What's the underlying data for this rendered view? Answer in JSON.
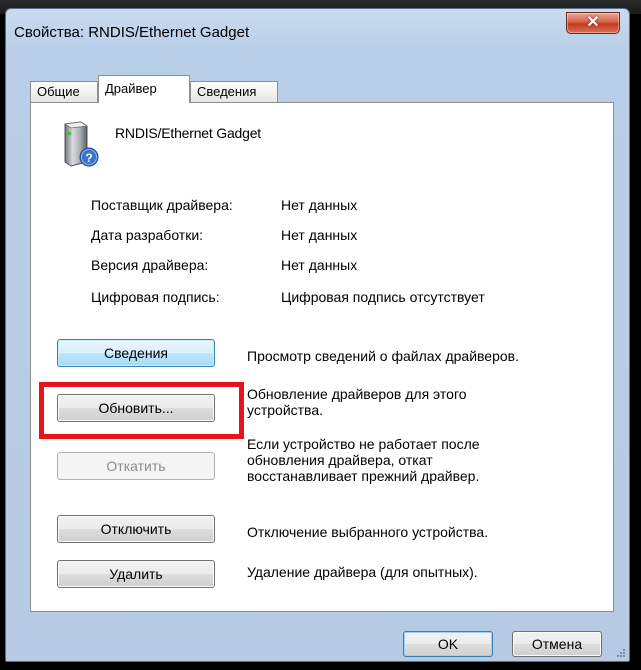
{
  "window": {
    "title": "Свойства: RNDIS/Ethernet Gadget",
    "close_label": "✕"
  },
  "tabs": [
    {
      "label": "Общие",
      "active": false
    },
    {
      "label": "Драйвер",
      "active": true
    },
    {
      "label": "Сведения",
      "active": false
    }
  ],
  "device": {
    "name": "RNDIS/Ethernet Gadget",
    "icon": "unknown-device-icon"
  },
  "properties": [
    {
      "label": "Поставщик драйвера:",
      "value": "Нет данных"
    },
    {
      "label": "Дата разработки:",
      "value": "Нет данных"
    },
    {
      "label": "Версия драйвера:",
      "value": "Нет данных"
    },
    {
      "label": "Цифровая подпись:",
      "value": "Цифровая подпись отсутствует"
    }
  ],
  "actions": [
    {
      "button": "Сведения",
      "description": [
        "Просмотр сведений о файлах драйверов."
      ],
      "state": "focused"
    },
    {
      "button": "Обновить...",
      "description": [
        "Обновление драйверов для этого",
        "устройства."
      ],
      "state": "normal"
    },
    {
      "button": "Откатить",
      "description": [
        "Если устройство не работает после",
        "обновления драйвера, откат",
        "восстанавливает прежний драйвер."
      ],
      "state": "disabled"
    },
    {
      "button": "Отключить",
      "description": [
        "Отключение выбранного устройства."
      ],
      "state": "normal"
    },
    {
      "button": "Удалить",
      "description": [
        "Удаление драйвера (для опытных)."
      ],
      "state": "normal"
    }
  ],
  "footer": {
    "ok_label": "OK",
    "cancel_label": "Отмена"
  },
  "colors": {
    "highlight": "#e8141b",
    "close_button": "#c53a1f"
  }
}
